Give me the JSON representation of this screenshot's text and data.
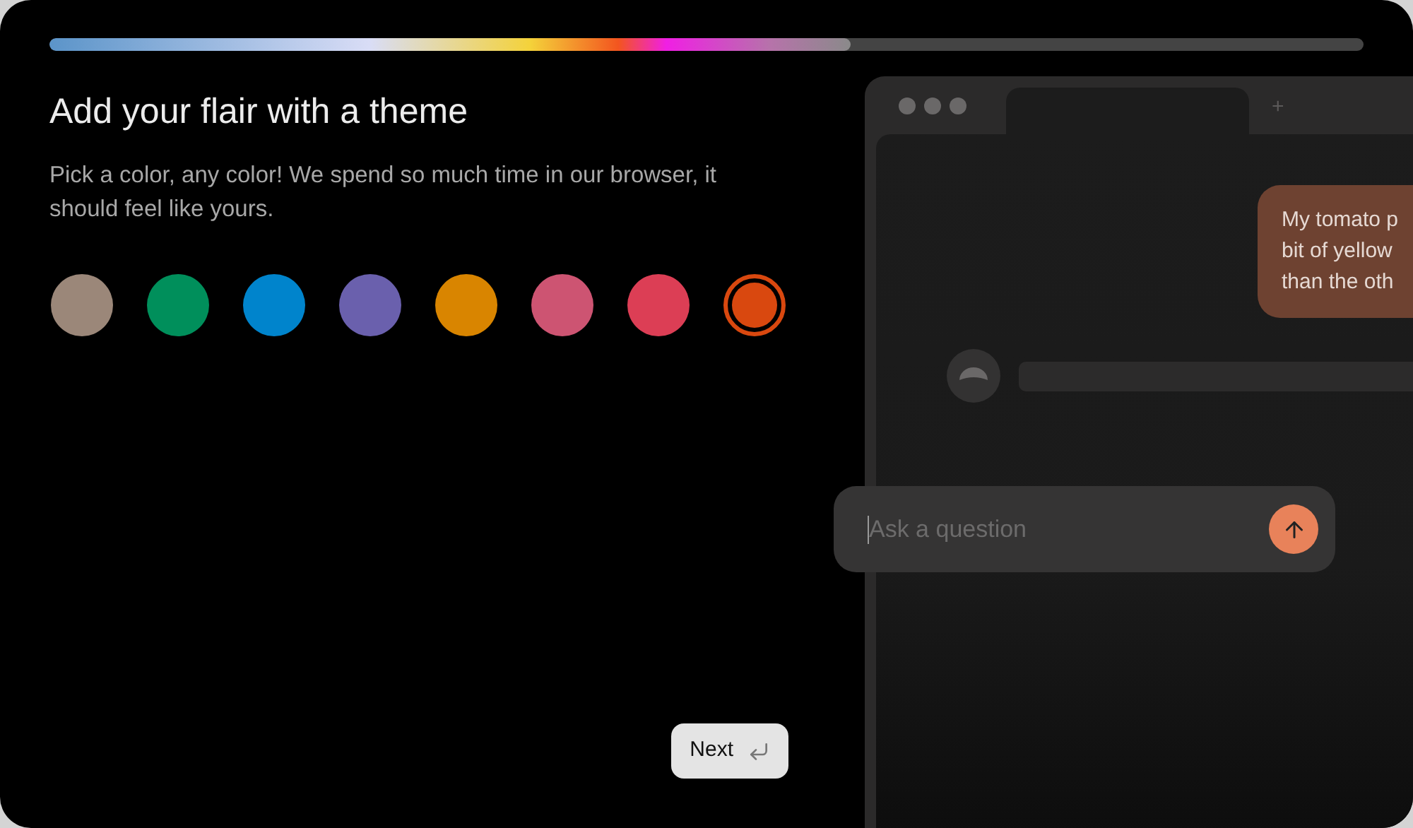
{
  "progress": {
    "level": 0.61
  },
  "title": "Add your flair with a theme",
  "description": "Pick a color, any color! We spend so much time in our browser, it should feel like yours.",
  "swatches": [
    {
      "color": "#9b8779",
      "selected": false
    },
    {
      "color": "#008f5b",
      "selected": false
    },
    {
      "color": "#0084cc",
      "selected": false
    },
    {
      "color": "#6a60ad",
      "selected": false
    },
    {
      "color": "#d98500",
      "selected": false
    },
    {
      "color": "#cd5472",
      "selected": false
    },
    {
      "color": "#dc3e55",
      "selected": false
    },
    {
      "color": "#d9480f",
      "selected": true
    }
  ],
  "preview": {
    "new_tab": "+",
    "message_lines": [
      "My tomato p",
      "bit of yellow",
      "than the oth"
    ],
    "input": {
      "placeholder": "Ask a question"
    }
  },
  "next_button": {
    "label": "Next"
  }
}
